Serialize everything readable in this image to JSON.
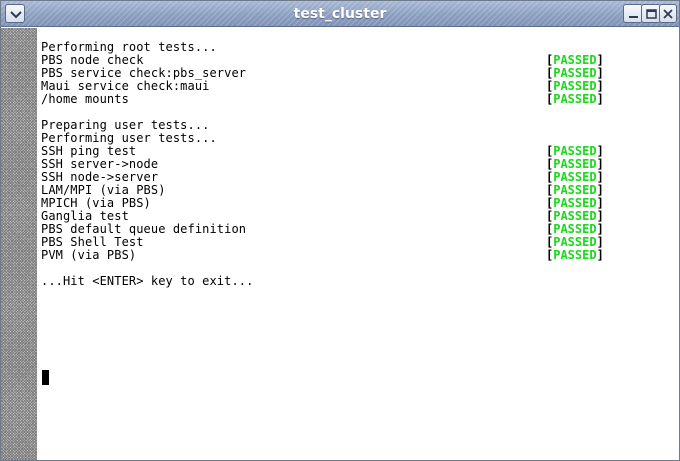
{
  "window": {
    "title": "test_cluster"
  },
  "colors": {
    "passed": "#19d919",
    "titlebar": "#8c9fc0",
    "text": "#000000"
  },
  "terminal": {
    "lines": [
      {
        "text": "Performing root tests...",
        "status": ""
      },
      {
        "text": "PBS node check",
        "status": "PASSED"
      },
      {
        "text": "PBS service check:pbs_server",
        "status": "PASSED"
      },
      {
        "text": "Maui service check:maui",
        "status": "PASSED"
      },
      {
        "text": "/home mounts",
        "status": "PASSED"
      },
      {
        "text": "",
        "status": ""
      },
      {
        "text": "Preparing user tests...",
        "status": ""
      },
      {
        "text": "Performing user tests...",
        "status": ""
      },
      {
        "text": "SSH ping test",
        "status": "PASSED"
      },
      {
        "text": "SSH server->node",
        "status": "PASSED"
      },
      {
        "text": "SSH node->server",
        "status": "PASSED"
      },
      {
        "text": "LAM/MPI (via PBS)",
        "status": "PASSED"
      },
      {
        "text": "MPICH (via PBS)",
        "status": "PASSED"
      },
      {
        "text": "Ganglia test",
        "status": "PASSED"
      },
      {
        "text": "PBS default queue definition",
        "status": "PASSED"
      },
      {
        "text": "PBS Shell Test",
        "status": "PASSED"
      },
      {
        "text": "PVM (via PBS)",
        "status": "PASSED"
      },
      {
        "text": "",
        "status": ""
      },
      {
        "text": "...Hit <ENTER> key to exit...",
        "status": ""
      }
    ],
    "bracket_open": "[",
    "bracket_close": "]"
  }
}
